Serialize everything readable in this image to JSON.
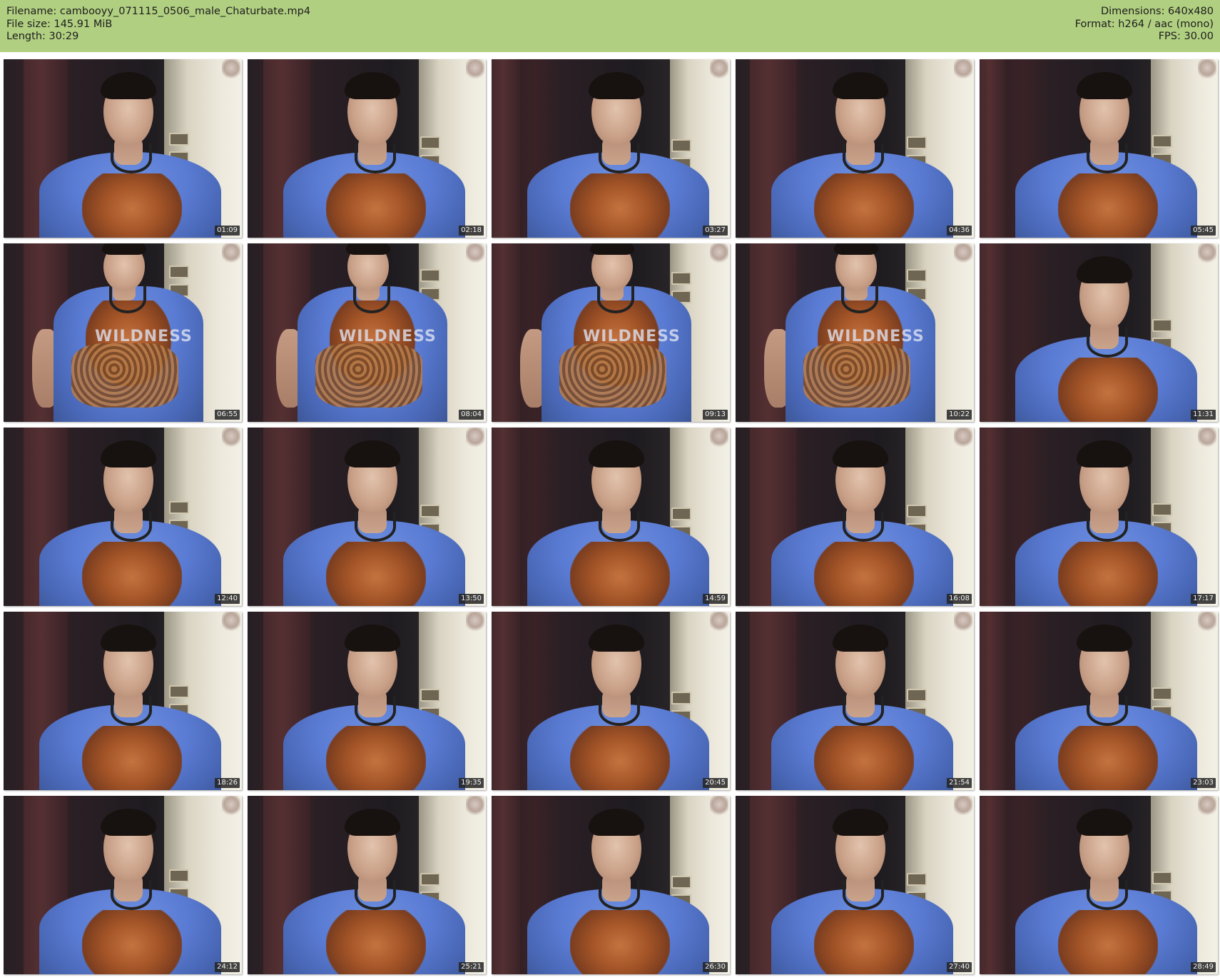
{
  "header": {
    "filename": "Filename: cambooyy_071115_0506_male_Chaturbate.mp4",
    "filesize": "File size: 145.91 MiB",
    "length": "Length: 30:29",
    "dimensions": "Dimensions: 640x480",
    "format": "Format: h264 / aac (mono)",
    "fps": "FPS: 30.00",
    "bg_color": "#b1cf81"
  },
  "thumbnails": [
    {
      "time": "01:09",
      "pose": "near"
    },
    {
      "time": "02:18",
      "pose": "near"
    },
    {
      "time": "03:27",
      "pose": "near"
    },
    {
      "time": "04:36",
      "pose": "near"
    },
    {
      "time": "05:45",
      "pose": "near"
    },
    {
      "time": "06:55",
      "pose": "far"
    },
    {
      "time": "08:04",
      "pose": "far"
    },
    {
      "time": "09:13",
      "pose": "far"
    },
    {
      "time": "10:22",
      "pose": "far"
    },
    {
      "time": "11:31",
      "pose": "near"
    },
    {
      "time": "12:40",
      "pose": "near"
    },
    {
      "time": "13:50",
      "pose": "near"
    },
    {
      "time": "14:59",
      "pose": "near"
    },
    {
      "time": "16:08",
      "pose": "near"
    },
    {
      "time": "17:17",
      "pose": "near"
    },
    {
      "time": "18:26",
      "pose": "near"
    },
    {
      "time": "19:35",
      "pose": "near"
    },
    {
      "time": "20:45",
      "pose": "near"
    },
    {
      "time": "21:54",
      "pose": "near"
    },
    {
      "time": "23:03",
      "pose": "near"
    },
    {
      "time": "24:12",
      "pose": "near"
    },
    {
      "time": "25:21",
      "pose": "near"
    },
    {
      "time": "26:30",
      "pose": "near"
    },
    {
      "time": "27:40",
      "pose": "near"
    },
    {
      "time": "28:49",
      "pose": "near"
    }
  ],
  "shirt_text": "WILDNESS"
}
